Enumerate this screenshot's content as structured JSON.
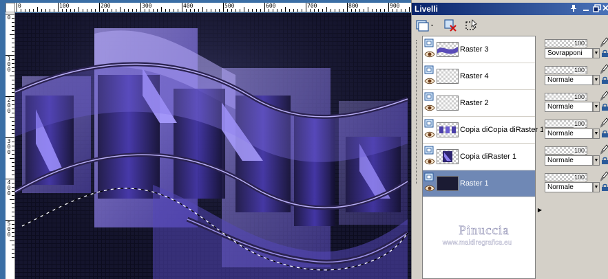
{
  "ruler": {
    "h_labels": [
      "0",
      "100",
      "200",
      "300",
      "400",
      "500",
      "600",
      "700",
      "800",
      "900"
    ],
    "v_labels": [
      "0",
      "1\n0\n0",
      "2\n0\n0",
      "3\n0\n0",
      "4\n0\n0",
      "5\n0\n0"
    ]
  },
  "panel": {
    "title": "Livelli",
    "icons": {
      "pin": "pin-icon",
      "window": "window-icon",
      "close": "close-icon"
    }
  },
  "layers": [
    {
      "name": "Raster 3",
      "thumb": "wave",
      "opacity": "100",
      "blend": "Sovrapponi",
      "selected": false
    },
    {
      "name": "Raster 4",
      "thumb": "empty",
      "opacity": "100",
      "blend": "Normale",
      "selected": false
    },
    {
      "name": "Raster 2",
      "thumb": "empty",
      "opacity": "100",
      "blend": "Normale",
      "selected": false
    },
    {
      "name": "Copia diCopia diRaster 1",
      "thumb": "blocks",
      "opacity": "100",
      "blend": "Normale",
      "selected": false
    },
    {
      "name": "Copia diRaster 1",
      "thumb": "square",
      "opacity": "100",
      "blend": "Normale",
      "selected": false
    },
    {
      "name": "Raster 1",
      "thumb": "dark",
      "opacity": "100",
      "blend": "Normale",
      "selected": true
    }
  ],
  "watermark": {
    "name": "Pinuccia",
    "url": "www.maidiregrafica.eu"
  },
  "colors": {
    "selected_row": "#6f88b5",
    "titlebar": "#0a246a",
    "purple_light": "#9d8ff0",
    "purple_dark": "#3a2a90"
  }
}
